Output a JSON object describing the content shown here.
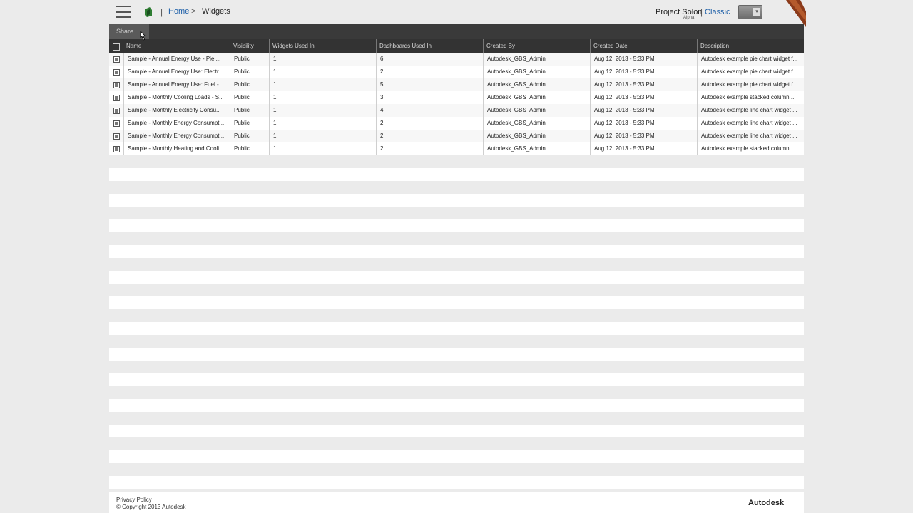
{
  "header": {
    "breadcrumb_home": "Home",
    "breadcrumb_sep": ">",
    "breadcrumb_current": "Widgets",
    "project_name": "Project Solon",
    "project_stage": "Alpha",
    "separator": "|",
    "classic_link": "Classic",
    "user_menu_caret": "▾"
  },
  "toolbar": {
    "tab_label": "Share"
  },
  "table": {
    "columns": [
      "Name",
      "Visibility",
      "Widgets Used In",
      "Dashboards Used In",
      "Created By",
      "Created Date",
      "Description"
    ],
    "rows": [
      [
        "Sample - Annual Energy Use - Pie ...",
        "Public",
        "1",
        "6",
        "Autodesk_GBS_Admin",
        "Aug 12, 2013 - 5:33 PM",
        "Autodesk example pie chart widget f..."
      ],
      [
        "Sample - Annual Energy Use: Electr...",
        "Public",
        "1",
        "2",
        "Autodesk_GBS_Admin",
        "Aug 12, 2013 - 5:33 PM",
        "Autodesk example pie chart widget f..."
      ],
      [
        "Sample - Annual Energy Use: Fuel - ...",
        "Public",
        "1",
        "5",
        "Autodesk_GBS_Admin",
        "Aug 12, 2013 - 5:33 PM",
        "Autodesk example pie chart widget f..."
      ],
      [
        "Sample - Monthly Cooling Loads - S...",
        "Public",
        "1",
        "3",
        "Autodesk_GBS_Admin",
        "Aug 12, 2013 - 5:33 PM",
        "Autodesk example stacked column ..."
      ],
      [
        "Sample - Monthly Electricity Consu...",
        "Public",
        "1",
        "4",
        "Autodesk_GBS_Admin",
        "Aug 12, 2013 - 5:33 PM",
        "Autodesk example line chart widget ..."
      ],
      [
        "Sample - Monthly Energy Consumpt...",
        "Public",
        "1",
        "2",
        "Autodesk_GBS_Admin",
        "Aug 12, 2013 - 5:33 PM",
        "Autodesk example line chart widget ..."
      ],
      [
        "Sample - Monthly Energy Consumpt...",
        "Public",
        "1",
        "2",
        "Autodesk_GBS_Admin",
        "Aug 12, 2013 - 5:33 PM",
        "Autodesk example line chart widget ..."
      ],
      [
        "Sample - Monthly Heating and Cooli...",
        "Public",
        "1",
        "2",
        "Autodesk_GBS_Admin",
        "Aug 12, 2013 - 5:33 PM",
        "Autodesk example stacked column ..."
      ]
    ]
  },
  "footer": {
    "privacy": "Privacy Policy",
    "copyright": "© Copyright 2013 Autodesk",
    "brand": "Autodesk"
  },
  "colors": {
    "link": "#1d5fa8",
    "toolbar": "#3a3a3a",
    "logo_green": "#2e7d32",
    "corner_rust": "#8b3a1a"
  }
}
